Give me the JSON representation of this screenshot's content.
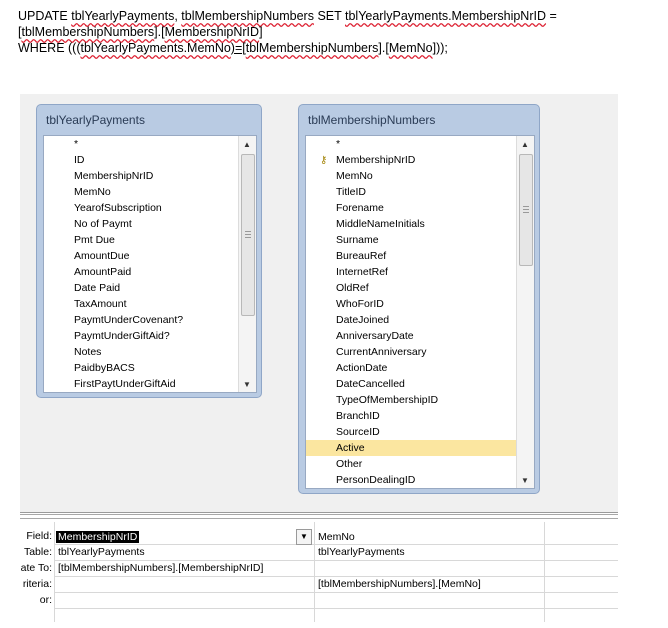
{
  "sql": {
    "line1": {
      "p1": "UPDATE ",
      "p2": "tblYearlyPayments",
      "p3": ", ",
      "p4": "tblMembershipNumbers",
      "p5": " SET ",
      "p6": "tblYearlyPayments.MembershipNrID",
      "p7": " ="
    },
    "line2": {
      "p1": "[",
      "p2": "tblMembershipNumbers",
      "p3": "].[",
      "p4": "MembershipNrID",
      "p5": "]"
    },
    "line3": {
      "p1": "WHERE (((",
      "p2": "tblYearlyPayments.MemNo",
      "p3": ")=[",
      "p4": "tblMembershipNumbers",
      "p5": "].[",
      "p6": "MemNo",
      "p7": "]));"
    }
  },
  "table1": {
    "title": "tblYearlyPayments",
    "fields": [
      "*",
      "ID",
      "MembershipNrID",
      "MemNo",
      "YearofSubscription",
      "No of Paymt",
      "Pmt Due",
      "AmountDue",
      "AmountPaid",
      "Date Paid",
      "TaxAmount",
      "PaymtUnderCovenant?",
      "PaymtUnderGiftAid?",
      "Notes",
      "PaidbyBACS",
      "FirstPaytUnderGiftAid"
    ]
  },
  "table2": {
    "title": "tblMembershipNumbers",
    "fields": [
      "*",
      "MembershipNrID",
      "MemNo",
      "TitleID",
      "Forename",
      "MiddleNameInitials",
      "Surname",
      "BureauRef",
      "InternetRef",
      "OldRef",
      "WhoForID",
      "DateJoined",
      "AnniversaryDate",
      "CurrentAnniversary",
      "ActionDate",
      "DateCancelled",
      "TypeOfMembershipID",
      "BranchID",
      "SourceID",
      "Active",
      "Other",
      "PersonDealingID"
    ],
    "selected": "Active"
  },
  "grid": {
    "labels": {
      "field": "Field:",
      "table": "Table:",
      "update_to": "ate To:",
      "criteria": "riteria:",
      "or": "or:"
    },
    "col1": {
      "field": "MembershipNrID",
      "table": "tblYearlyPayments",
      "update_to": "[tblMembershipNumbers].[MembershipNrID]",
      "criteria": ""
    },
    "col2": {
      "field": "MemNo",
      "table": "tblYearlyPayments",
      "update_to": "",
      "criteria": "[tblMembershipNumbers].[MemNo]"
    }
  },
  "icons": {
    "key": "key-icon",
    "up": "arrow-up-icon",
    "down": "arrow-down-icon",
    "dropdown": "chevron-down-icon"
  }
}
